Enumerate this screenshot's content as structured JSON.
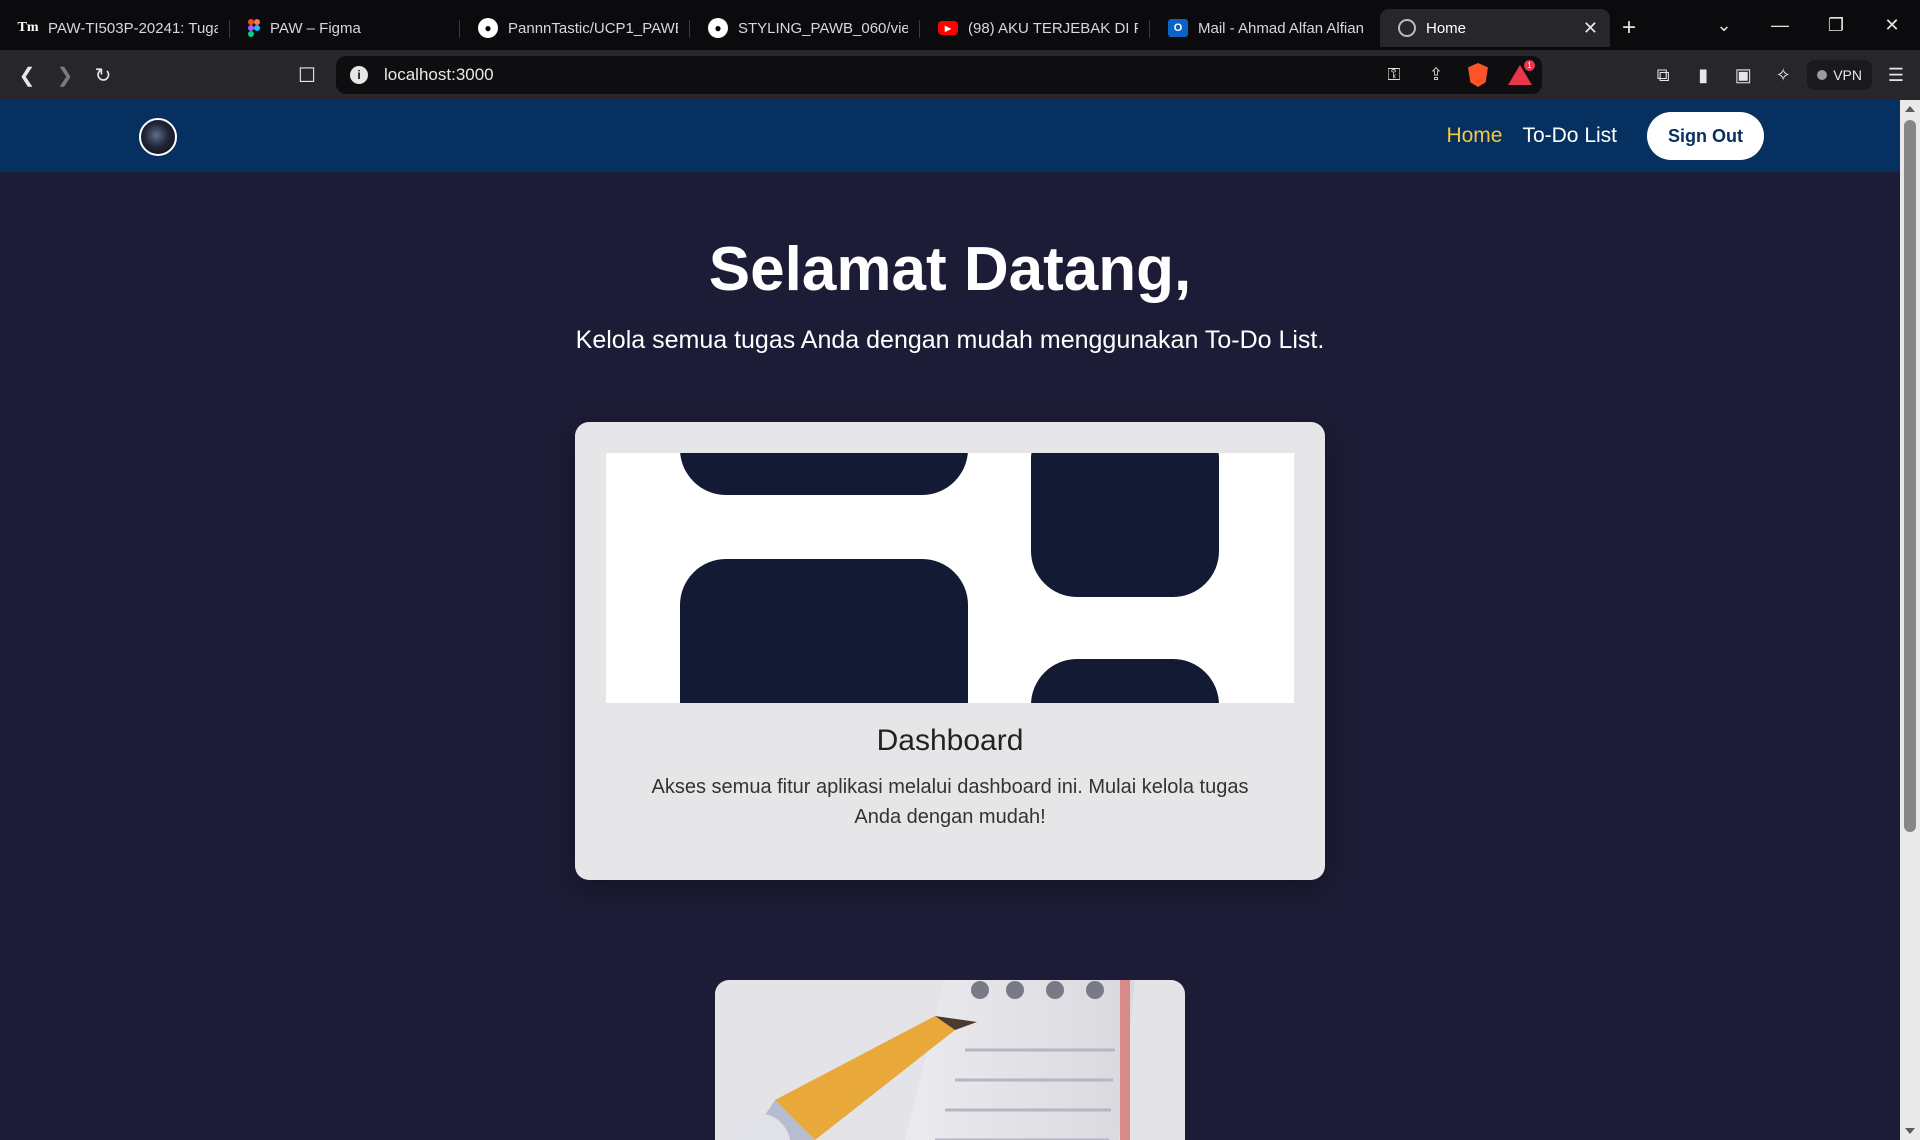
{
  "browser": {
    "tabs": [
      {
        "title": "PAW-TI503P-20241: Tugas",
        "icon": "tm-icon"
      },
      {
        "title": "PAW – Figma",
        "icon": "figma-icon"
      },
      {
        "title": "PannnTastic/UCP1_PAWB",
        "icon": "github-icon"
      },
      {
        "title": "STYLING_PAWB_060/view",
        "icon": "github-icon"
      },
      {
        "title": "(98) AKU TERJEBAK DI PE",
        "icon": "youtube-icon"
      },
      {
        "title": "Mail - Ahmad Alfan Alfian",
        "icon": "outlook-icon"
      },
      {
        "title": "Home",
        "icon": "globe-icon"
      }
    ],
    "address": "localhost:3000",
    "vpn_label": "VPN",
    "rewards_badge": "1"
  },
  "nav": {
    "links": [
      "Home",
      "To-Do List"
    ],
    "signout": "Sign Out",
    "active_color": "#f5c842",
    "bar_color": "#05305f"
  },
  "hero": {
    "title": "Selamat Datang,",
    "subtitle": "Kelola semua tugas Anda dengan mudah menggunakan To-Do List."
  },
  "cards": [
    {
      "title": "Dashboard",
      "description": "Akses semua fitur aplikasi melalui dashboard ini. Mulai kelola tugas Anda dengan mudah!"
    }
  ],
  "colors": {
    "page_bg": "#1d1c36",
    "card_bg": "#e6e6e9",
    "blob": "#131a33"
  }
}
